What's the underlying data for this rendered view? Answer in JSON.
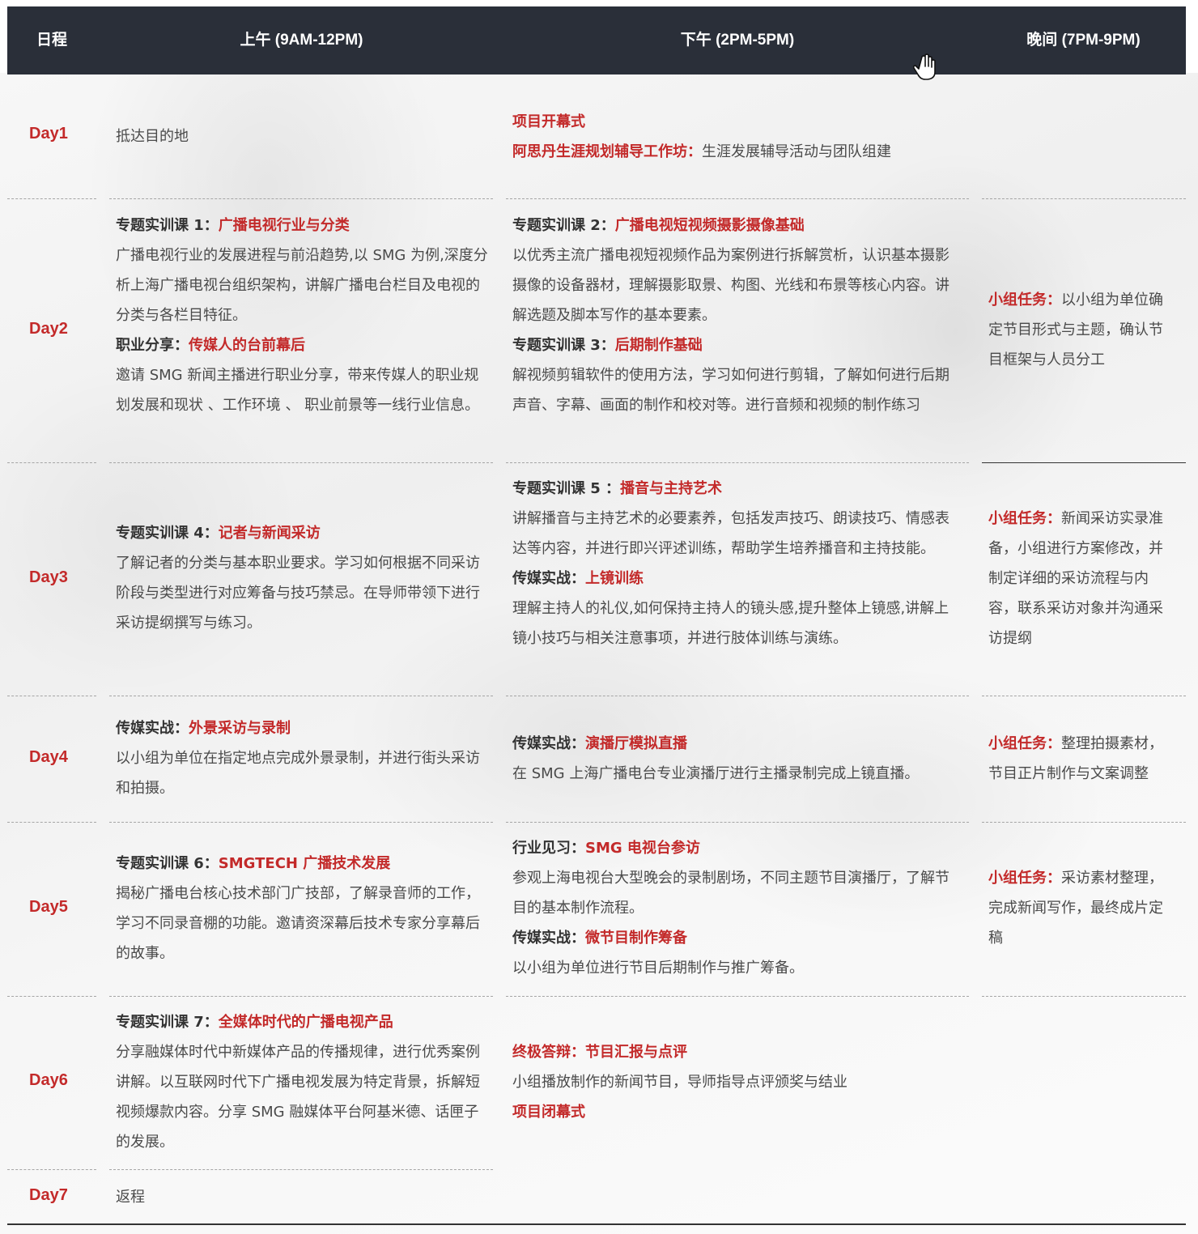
{
  "header": {
    "col_day": "日程",
    "col_am": "上午 (9AM-12PM)",
    "col_pm": "下午 (2PM-5PM)",
    "col_ev": "晚间 (7PM-9PM)"
  },
  "days": {
    "d1": {
      "label": "Day1",
      "am": "抵达目的地",
      "pm_opening": "项目开幕式",
      "pm_workshop_label": "阿思丹生涯规划辅导工作坊：",
      "pm_workshop_text": "生涯发展辅导活动与团队组建"
    },
    "d2": {
      "label": "Day2",
      "am_course_label": "专题实训课 1：",
      "am_course_title": "广播电视行业与分类",
      "am_course_text": "广播电视行业的发展进程与前沿趋势,以 SMG 为例,深度分析上海广播电视台组织架构，讲解广播电台栏目及电视的分类与各栏目特征。",
      "am_share_label": "职业分享：",
      "am_share_title": "传媒人的台前幕后",
      "am_share_text": "邀请 SMG 新闻主播进行职业分享，带来传媒人的职业规划发展和现状 、工作环境 、 职业前景等一线行业信息。",
      "pm_course2_label": "专题实训课 2：",
      "pm_course2_title": "广播电视短视频摄影摄像基础",
      "pm_course2_text": "以优秀主流广播电视短视频作品为案例进行拆解赏析，认识基本摄影摄像的设备器材，理解摄影取景、构图、光线和布景等核心内容。讲解选题及脚本写作的基本要素。",
      "pm_course3_label": "专题实训课 3：",
      "pm_course3_title": "后期制作基础",
      "pm_course3_text": "解视频剪辑软件的使用方法，学习如何进行剪辑，了解如何进行后期声音、字幕、画面的制作和校对等。进行音频和视频的制作练习",
      "ev_label": "小组任务：",
      "ev_text": "以小组为单位确定节目形式与主题，确认节目框架与人员分工"
    },
    "d3": {
      "label": "Day3",
      "am_course_label": "专题实训课 4：",
      "am_course_title": "记者与新闻采访",
      "am_course_text": "了解记者的分类与基本职业要求。学习如何根据不同采访阶段与类型进行对应筹备与技巧禁忌。在导师带领下进行采访提纲撰写与练习。",
      "pm_course5_label": "专题实训课 5 ：",
      "pm_course5_title": "播音与主持艺术",
      "pm_course5_text": "讲解播音与主持艺术的必要素养，包括发声技巧、朗读技巧、情感表达等内容，并进行即兴评述训练，帮助学生培养播音和主持技能。",
      "pm_practice_label": "传媒实战：",
      "pm_practice_title": "上镜训练",
      "pm_practice_text": "理解主持人的礼仪,如何保持主持人的镜头感,提升整体上镜感,讲解上镜小技巧与相关注意事项，并进行肢体训练与演练。",
      "ev_label": "小组任务：",
      "ev_text": "新闻采访实录准备，小组进行方案修改，并制定详细的采访流程与内容，联系采访对象并沟通采访提纲"
    },
    "d4": {
      "label": "Day4",
      "am_label": "传媒实战：",
      "am_title": "外景采访与录制",
      "am_text": "以小组为单位在指定地点完成外景录制，并进行街头采访和拍摄。",
      "pm_label": "传媒实战：",
      "pm_title": "演播厅模拟直播",
      "pm_text": "在 SMG 上海广播电台专业演播厅进行主播录制完成上镜直播。",
      "ev_label": "小组任务：",
      "ev_text": "整理拍摄素材，节目正片制作与文案调整"
    },
    "d5": {
      "label": "Day5",
      "am_label": "专题实训课 6：",
      "am_title": "SMGTECH 广播技术发展",
      "am_text": "揭秘广播电台核心技术部门广技部，了解录音师的工作，学习不同录音棚的功能。邀请资深幕后技术专家分享幕后的故事。",
      "pm_visit_label": "行业见习：",
      "pm_visit_title": "SMG 电视台参访",
      "pm_visit_text": "参观上海电视台大型晚会的录制剧场，不同主题节目演播厅，了解节目的基本制作流程。",
      "pm_practice_label": "传媒实战：",
      "pm_practice_title": "微节目制作筹备",
      "pm_practice_text": "以小组为单位进行节目后期制作与推广筹备。",
      "ev_label": "小组任务：",
      "ev_text": "采访素材整理，完成新闻写作，最终成片定稿"
    },
    "d6": {
      "label": "Day6",
      "am_label": "专题实训课 7：",
      "am_title": "全媒体时代的广播电视产品",
      "am_text": "分享融媒体时代中新媒体产品的传播规律，进行优秀案例讲解。以互联网时代下广播电视发展为特定背景，拆解短视频爆款内容。分享 SMG 融媒体平台阿基米德、话匣子的发展。",
      "pm_final": "终极答辩：节目汇报与点评",
      "pm_text": "小组播放制作的新闻节目，导师指导点评颁奖与结业",
      "pm_closing": "项目闭幕式"
    },
    "d7": {
      "label": "Day7",
      "am": "返程"
    }
  },
  "colors": {
    "header_bg": "#2a2f39",
    "accent_red": "#c32a2a",
    "body_text": "#4a4a4a"
  },
  "icons": [
    "hand-cursor-icon"
  ]
}
